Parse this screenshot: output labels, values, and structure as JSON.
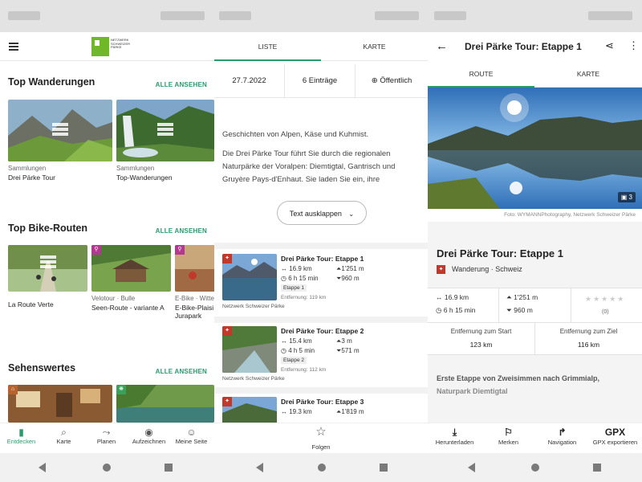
{
  "discover": {
    "sections": [
      {
        "title": "Top Wanderungen",
        "see_all": "ALLE ANSEHEN",
        "cards": [
          {
            "category": "Sammlungen",
            "name": "Drei Pärke Tour"
          },
          {
            "category": "Sammlungen",
            "name": "Top-Wanderungen"
          }
        ]
      },
      {
        "title": "Top Bike-Routen",
        "see_all": "ALLE ANSEHEN",
        "cards": [
          {
            "category": "",
            "name": "La Route Verte"
          },
          {
            "category": "Velotour · Bulle",
            "name": "Seen-Route - variante A"
          },
          {
            "category": "E-Bike · Witte",
            "name": "E-Bike-Plaisi\nJurapark"
          }
        ]
      },
      {
        "title": "Sehenswertes",
        "see_all": "ALLE ANSEHEN"
      }
    ],
    "bottom_nav": [
      {
        "label": "Entdecken",
        "icon": "bookmark-flag-icon",
        "active": true
      },
      {
        "label": "Karte",
        "icon": "map-search-icon"
      },
      {
        "label": "Planen",
        "icon": "route-plan-icon"
      },
      {
        "label": "Aufzeichnen",
        "icon": "record-icon"
      },
      {
        "label": "Meine Seite",
        "icon": "person-icon"
      }
    ]
  },
  "collection": {
    "tabs": [
      "LISTE",
      "KARTE"
    ],
    "meta": {
      "date": "27.7.2022",
      "entries": "6 Einträge",
      "visibility": "Öffentlich"
    },
    "description": [
      "Geschichten von Alpen, Käse und Kuhmist.",
      "Die Drei Pärke Tour führt Sie durch die regionalen Naturpärke der Voralpen: Diemtigtal, Gantrisch und Gruyère Pays-d'Enhaut. Sie laden Sie ein, ihre"
    ],
    "expand_label": "Text ausklappen",
    "stages": [
      {
        "title": "Drei Pärke Tour: Etappe 1",
        "distance": "16.9 km",
        "ascent": "1'251 m",
        "duration": "6 h 15 min",
        "descent": "960 m",
        "tag": "Etappe 1",
        "from": "Entfernung: 119 km",
        "source": "Netzwerk Schweizer Pärke"
      },
      {
        "title": "Drei Pärke Tour: Etappe 2",
        "distance": "15.4 km",
        "ascent": "3 m",
        "duration": "4 h 5 min",
        "descent": "571 m",
        "tag": "Etappe 2",
        "from": "Entfernung: 112 km",
        "source": "Netzwerk Schweizer Pärke"
      },
      {
        "title": "Drei Pärke Tour: Etappe 3",
        "distance": "19.3 km",
        "ascent": "1'819 m"
      }
    ],
    "follow_label": "Folgen"
  },
  "detail": {
    "app_title": "Drei Pärke Tour: Etappe 1",
    "tabs": [
      "ROUTE",
      "KARTE"
    ],
    "photo_count": "3",
    "credit": "Foto: WYMANNPhotography, Netzwerk Schweizer Pärke",
    "title": "Drei Pärke Tour: Etappe 1",
    "subtitle": "Wanderung · Schweiz",
    "stats": {
      "distance": "16.9 km",
      "duration": "6 h 15 min",
      "ascent": "1'251 m",
      "descent": "960 m",
      "rating_count": "(0)"
    },
    "distance_start_label": "Entfernung zum Start",
    "distance_start": "123 km",
    "distance_goal_label": "Entfernung zum Ziel",
    "distance_goal": "116 km",
    "intro_line1": "Erste Etappe von Zweisimmen nach Grimmialp,",
    "intro_line2": "Naturpark Diemtigtal",
    "actions": [
      {
        "label": "Herunterladen",
        "icon": "download-icon"
      },
      {
        "label": "Merken",
        "icon": "bookmark-icon"
      },
      {
        "label": "Navigation",
        "icon": "navigation-arrow-icon"
      },
      {
        "label": "GPX exportieren",
        "icon": "gpx-icon",
        "glyph": "GPX"
      }
    ]
  }
}
